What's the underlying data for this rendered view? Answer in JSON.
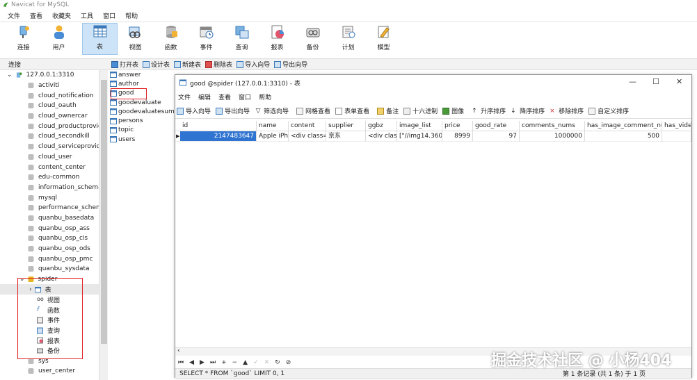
{
  "app": {
    "title": "Navicat for MySQL"
  },
  "menu": [
    "文件",
    "查看",
    "收藏夹",
    "工具",
    "窗口",
    "帮助"
  ],
  "toolbar": [
    {
      "label": "连接",
      "icon": "connection-icon"
    },
    {
      "label": "用户",
      "icon": "user-icon"
    },
    {
      "label": "表",
      "icon": "table-icon",
      "active": true
    },
    {
      "label": "视图",
      "icon": "view-icon"
    },
    {
      "label": "函数",
      "icon": "function-icon"
    },
    {
      "label": "事件",
      "icon": "event-icon"
    },
    {
      "label": "查询",
      "icon": "query-icon"
    },
    {
      "label": "报表",
      "icon": "report-icon"
    },
    {
      "label": "备份",
      "icon": "backup-icon"
    },
    {
      "label": "计划",
      "icon": "schedule-icon"
    },
    {
      "label": "模型",
      "icon": "model-icon"
    }
  ],
  "connbar": {
    "label": "连接",
    "ops": [
      "打开表",
      "设计表",
      "新建表",
      "删除表",
      "导入向导",
      "导出向导"
    ]
  },
  "sidebar": {
    "connection": "127.0.0.1:3310",
    "databases": [
      "activiti",
      "cloud_notification",
      "cloud_oauth",
      "cloud_ownercar",
      "cloud_productprovid",
      "cloud_secondkill",
      "cloud_serviceprovide",
      "cloud_user",
      "content_center",
      "edu-common",
      "information_schema",
      "mysql",
      "performance_schem",
      "quanbu_basedata",
      "quanbu_osp_ass",
      "quanbu_osp_cis",
      "quanbu_osp_ods",
      "quanbu_osp_pmc",
      "quanbu_sysdata"
    ],
    "open_db": "spider",
    "open_db_children": [
      "表",
      "视图",
      "函数",
      "事件",
      "查询",
      "报表",
      "备份"
    ],
    "after": [
      "sys",
      "user_center"
    ]
  },
  "tables": [
    "answer",
    "author",
    "good",
    "goodevaluate",
    "goodevaluatesum",
    "persons",
    "topic",
    "users"
  ],
  "window": {
    "title": "good @spider (127.0.0.1:3310) - 表",
    "menu": [
      "文件",
      "编辑",
      "查看",
      "窗口",
      "帮助"
    ],
    "tools": [
      "导入向导",
      "导出向导",
      "筛选向导",
      "网格查看",
      "表单查看",
      "备注",
      "十六进制",
      "图像",
      "升序排序",
      "降序排序",
      "移除排序",
      "自定义排序"
    ],
    "columns": [
      "id",
      "name",
      "content",
      "supplier",
      "ggbz",
      "image_list",
      "price",
      "good_rate",
      "comments_nums",
      "has_image_comment_num",
      "has_vide"
    ],
    "rows": [
      [
        "2147483647",
        "Apple iPho",
        "<div class='",
        "京东",
        "<div class",
        "[\"//img14.360b",
        "8999",
        "97",
        "1000000",
        "500",
        ""
      ]
    ],
    "status_sql": "SELECT * FROM `good` LIMIT 0, 1",
    "status_count": "第 1 条记录 (共 1 条) 于 1 页"
  },
  "watermark": "掘金技术社区 @ 小杨404",
  "colors": {
    "accent": "#2f74d0",
    "highlight_box": "#e02020",
    "active_tool": "#cde3f7"
  }
}
